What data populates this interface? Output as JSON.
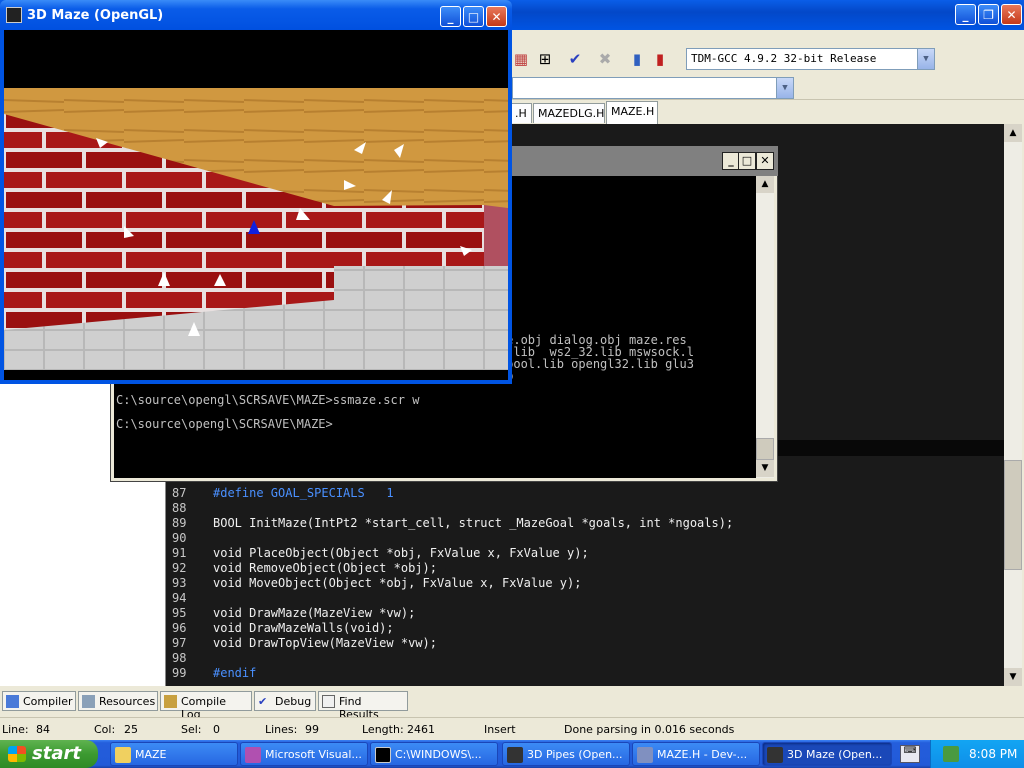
{
  "maze_window": {
    "title": "3D Maze (OpenGL)"
  },
  "devcpp": {
    "compiler_select": "TDM-GCC 4.9.2 32-bit Release",
    "tabs": [
      ".H",
      "MAZEDLG.H",
      "MAZE.H"
    ],
    "bottom_tabs": [
      "Compiler",
      "Resources",
      "Compile Log",
      "Debug",
      "Find Results"
    ],
    "status": {
      "line_label": "Line:",
      "line_value": "84",
      "col_label": "Col:",
      "col_value": "25",
      "sel_label": "Sel:",
      "sel_value": "0",
      "lines_label": "Lines:",
      "lines_value": "99",
      "length_label": "Length:",
      "length_value": "2461",
      "mode": "Insert",
      "message": "Done parsing in 0.016 seconds"
    }
  },
  "code_lines": [
    {
      "n": "87",
      "t": "#define GOAL_SPECIALS   1"
    },
    {
      "n": "88",
      "t": ""
    },
    {
      "n": "89",
      "t": "BOOL InitMaze(IntPt2 *start_cell, struct _MazeGoal *goals, int *ngoals);"
    },
    {
      "n": "90",
      "t": ""
    },
    {
      "n": "91",
      "t": "void PlaceObject(Object *obj, FxValue x, FxValue y);"
    },
    {
      "n": "92",
      "t": "void RemoveObject(Object *obj);"
    },
    {
      "n": "93",
      "t": "void MoveObject(Object *obj, FxValue x, FxValue y);"
    },
    {
      "n": "94",
      "t": ""
    },
    {
      "n": "95",
      "t": "void DrawMaze(MazeView *vw);"
    },
    {
      "n": "96",
      "t": "void DrawMazeWalls(void);"
    },
    {
      "n": "97",
      "t": "void DrawTopView(MazeView *vw);"
    },
    {
      "n": "98",
      "t": ""
    },
    {
      "n": "99",
      "t": "#endif"
    }
  ],
  "console_lines": [
    "WIN32_IE=0x0300 -DWINVER=0x040",
    "",
    "PI1=_cdecl -DCRTAPI2=_cdecl -n",
    "WIN32_IE=0x0300 -DWINVER=0x040",
    "",
    "PI1=_cdecl -DCRTAPI2=_cdecl -n",
    "WIN32_IE=0x0300 -DWINVER=0x040",
    "",
    "PI1=_cdecl -DCRTAPI2=_cdecl -n",
    "WIN32_IE=0x0300 -DWINVER=0x040",
    "",
    "LIB /INCREMENTAL:NO /PDB:NONE /",
    "MainCRTStartup -machine:i386 -o",
    "ut:ssmaze.scr genmaze.obj glmaze.obj ssmaze.obj slvmaze.obj dialog.obj maze.res",
    "..\\common\\sscommon.lib  libc.lib oldnames.lib kernel32.lib  ws2_32.lib mswsock.l",
    "ib advapi32.lib user32.lib gdi32.lib comdlg32.lib winspool.lib opengl32.lib glu3",
    "2.lib glaux.lib  scrnsave.lib comdlg32.lib comctl32.lib",
    "",
    "C:\\source\\opengl\\SCRSAVE\\MAZE>ssmaze.scr w",
    "",
    "C:\\source\\opengl\\SCRSAVE\\MAZE>"
  ],
  "taskbar": {
    "start": "start",
    "tasks": [
      "MAZE",
      "Microsoft Visual...",
      "C:\\WINDOWS\\...",
      "3D Pipes (Open...",
      "MAZE.H - Dev-...",
      "3D Maze (Open..."
    ],
    "clock": "8:08 PM"
  },
  "colors": {
    "accent": "#0054e3",
    "editor_bg": "#1a1a1a",
    "preprocessor": "#4a90ff"
  }
}
